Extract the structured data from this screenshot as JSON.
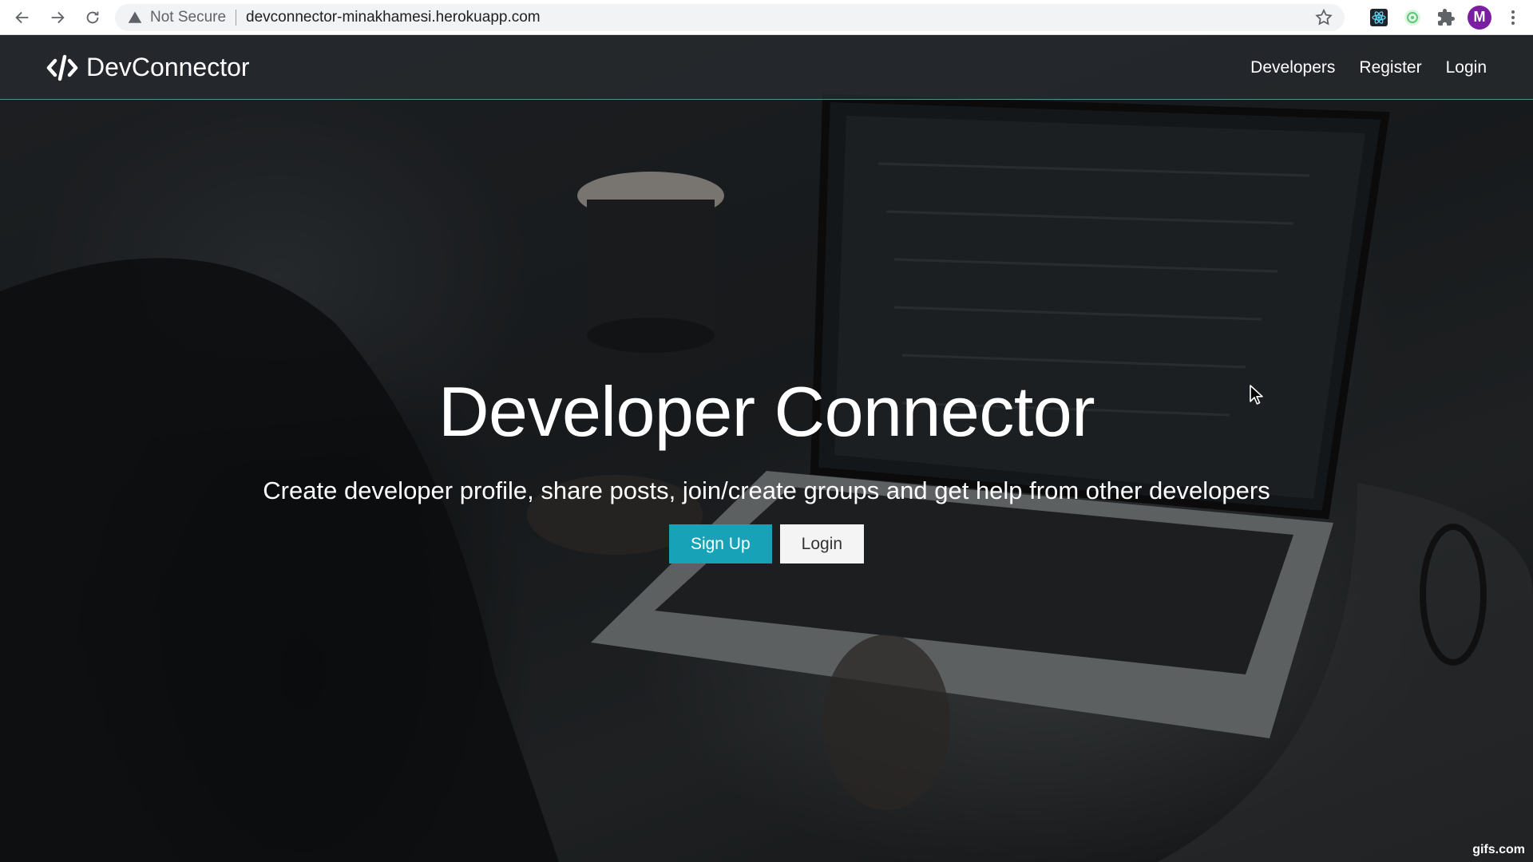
{
  "browser": {
    "security_label": "Not Secure",
    "url": "devconnector-minakhamesi.herokuapp.com",
    "profile_initial": "M",
    "icons": {
      "back": "arrow-left-icon",
      "forward": "arrow-right-icon",
      "reload": "reload-icon",
      "warning": "warning-triangle-icon",
      "bookmark": "star-icon",
      "extensions": "puzzle-icon",
      "menu": "vertical-dots-icon"
    }
  },
  "navbar": {
    "brand": "DevConnector",
    "brand_icon": "code-icon",
    "links": [
      "Developers",
      "Register",
      "Login"
    ]
  },
  "hero": {
    "title": "Developer Connector",
    "lead": "Create developer profile, share posts, join/create groups and get help from other developers",
    "buttons": {
      "signup": "Sign Up",
      "login": "Login"
    }
  },
  "colors": {
    "primary": "#17a2b8",
    "light": "#f4f4f4",
    "navbar_border": "#4f8f93",
    "avatar": "#7b1fa2"
  },
  "watermark": "gifs.com"
}
